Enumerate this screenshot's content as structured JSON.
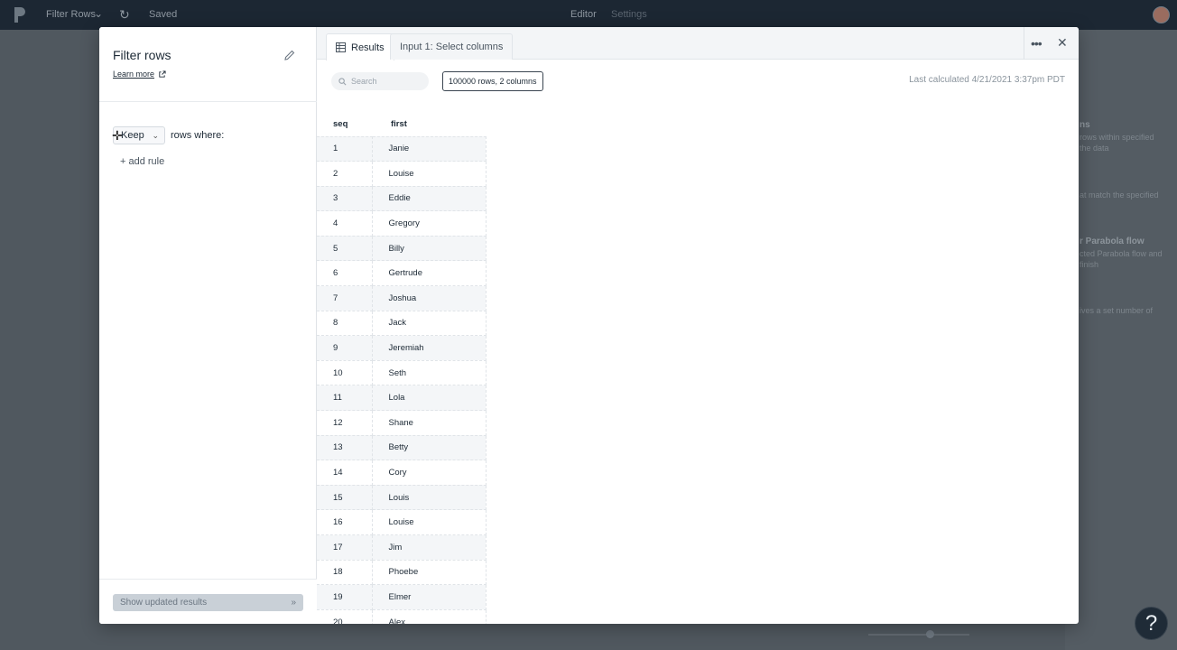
{
  "app": {
    "flow_name": "Filter Rows",
    "saved": "Saved",
    "nav_editor": "Editor",
    "nav_settings": "Settings"
  },
  "background_panel": {
    "lines": [
      "ns",
      "rows within specified",
      "the data",
      "at match the specified",
      "r Parabola flow",
      "cted Parabola flow and",
      "finish",
      "ives a set number of"
    ]
  },
  "modal": {
    "title": "Filter rows",
    "learn_more": "Learn more",
    "keep_value": "Keep",
    "rows_where": "rows where:",
    "add_rule": "+ add rule",
    "show_updated": "Show updated results",
    "show_updated_arrow": "»",
    "tabs": {
      "results": "Results",
      "input": "Input 1: Select columns"
    },
    "search_placeholder": "Search",
    "rows_badge": "100000 rows, 2 columns",
    "last_calculated": "Last calculated 4/21/2021 3:37pm PDT",
    "table": {
      "columns": [
        "seq",
        "first"
      ],
      "rows": [
        [
          "1",
          "Janie"
        ],
        [
          "2",
          "Louise"
        ],
        [
          "3",
          "Eddie"
        ],
        [
          "4",
          "Gregory"
        ],
        [
          "5",
          "Billy"
        ],
        [
          "6",
          "Gertrude"
        ],
        [
          "7",
          "Joshua"
        ],
        [
          "8",
          "Jack"
        ],
        [
          "9",
          "Jeremiah"
        ],
        [
          "10",
          "Seth"
        ],
        [
          "11",
          "Lola"
        ],
        [
          "12",
          "Shane"
        ],
        [
          "13",
          "Betty"
        ],
        [
          "14",
          "Cory"
        ],
        [
          "15",
          "Louis"
        ],
        [
          "16",
          "Louise"
        ],
        [
          "17",
          "Jim"
        ],
        [
          "18",
          "Phoebe"
        ],
        [
          "19",
          "Elmer"
        ],
        [
          "20",
          "Alex"
        ]
      ]
    }
  },
  "help_label": "?"
}
